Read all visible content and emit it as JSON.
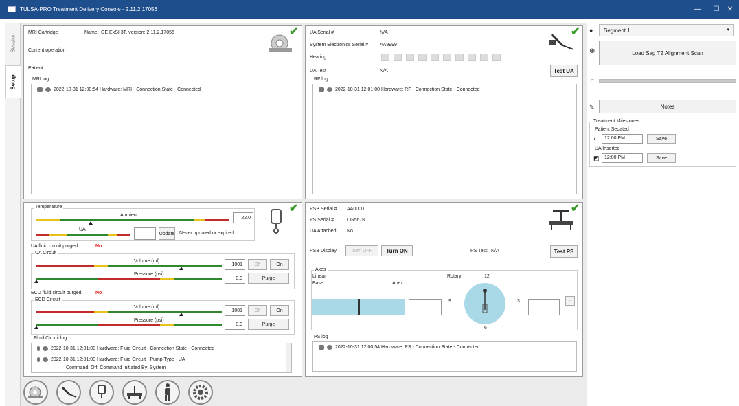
{
  "window": {
    "title": "TULSA-PRO Treatment Delivery Console - 2.11.2.17056",
    "minimize": "—",
    "maximize": "☐",
    "close": "✕"
  },
  "tabs": {
    "session": "Session",
    "setup": "Setup"
  },
  "mri": {
    "cartridge_label": "MRI Cartridge",
    "name_label": "Name:",
    "name_value": "GE ExSI 3T, version: 2.11.2.17056",
    "current_operation": "Current operation",
    "patient": "Patient",
    "log_title": "MRI log",
    "log": [
      "2022-10-31 12:00:54 Hardware: MRI - Connection State - Connected"
    ]
  },
  "ua": {
    "serial_label": "UA Serial #",
    "serial_value": "N/A",
    "sys_serial_label": "System Electronics Serial #",
    "sys_serial_value": "AA9999",
    "heating": "Heating",
    "test_label": "UA Test",
    "test_value": "N/A",
    "test_button": "Test UA",
    "log_title": "RF log",
    "log": [
      "2022-10-31 12:01:00 Hardware: RF - Connection State - Connected"
    ]
  },
  "fluid": {
    "temperature": "Temperature",
    "ambient": "Ambient",
    "ambient_value": "22.0",
    "ua_label": "UA",
    "ua_value": "",
    "update_btn": "Update",
    "never_updated": "Never updated or expired",
    "ua_purged_label": "UA fluid circuit purged:",
    "ua_purged_value": "No",
    "ua_circuit": "UA Circuit",
    "volume_label": "Volume (ml)",
    "ua_volume": "1001",
    "pressure_label": "Pressure (psi)",
    "ua_pressure": "0.0",
    "off_btn": "Off",
    "on_btn": "On",
    "purge_btn": "Purge",
    "ecd_purged_label": "ECD fluid circuit purged:",
    "ecd_purged_value": "No",
    "ecd_circuit": "ECD Circuit",
    "ecd_volume": "1001",
    "ecd_pressure": "0.0",
    "log_title": "Fluid Circuit log",
    "log": [
      "2022-10-31 12:01:00 Hardware: Fluid Circuit - Connection State - Connected",
      "2022-10-31 12:01:00 Hardware: Fluid Circuit - Pump Type - UA",
      "Command: Off, Command Initiated By: System"
    ]
  },
  "psb": {
    "psb_serial_label": "PSB Serial #",
    "psb_serial_value": "AA0000",
    "ps_serial_label": "PS Serial #",
    "ps_serial_value": "CG5678",
    "ua_attached_label": "UA Attached:",
    "ua_attached_value": "No",
    "display_label": "PSB Display",
    "turn_off": "Turn OFF",
    "turn_on": "Turn ON",
    "ps_test_label": "PS Test:",
    "ps_test_value": "N/A",
    "test_button": "Test PS",
    "axes": "Axes",
    "linear": "Linear",
    "base": "Base",
    "apex": "Apex",
    "rotary": "Rotary",
    "dial_12": "12",
    "dial_9": "9",
    "dial_3": "3",
    "dial_6": "6",
    "home_glyph": "⌂",
    "log_title": "PS log",
    "log": [
      "2022-10-31 12:00:54 Hardware: PS - Connection State - Connected"
    ]
  },
  "right": {
    "segment": "Segment 1",
    "load_scan": "Load Sag T2 Alignment Scan",
    "notes": "Notes",
    "milestones": "Treatment Milestones",
    "sedated": "Patient Sedated",
    "sedated_time": "12:00 PM",
    "inserted": "UA Inserted",
    "inserted_time": "12:00 PM",
    "save": "Save"
  },
  "colors": {
    "titlebar": "#1f4e8c",
    "check": "#3c9a2c",
    "warn": "#e01b1b",
    "axis_fill": "#a9d8e6"
  }
}
